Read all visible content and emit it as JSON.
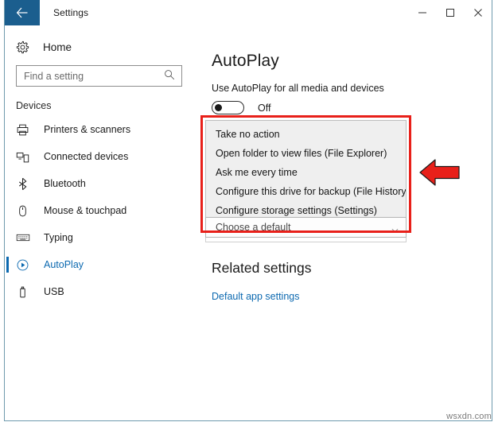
{
  "window": {
    "title": "Settings",
    "back_icon": "back-arrow-icon",
    "minimize_label": "Minimize",
    "maximize_label": "Maximize",
    "close_label": "Close"
  },
  "sidebar": {
    "home": {
      "label": "Home",
      "icon": "gear-icon"
    },
    "search": {
      "placeholder": "Find a setting",
      "value": "",
      "icon": "search-icon"
    },
    "section_label": "Devices",
    "items": [
      {
        "label": "Printers & scanners",
        "icon": "printer-icon",
        "selected": false
      },
      {
        "label": "Connected devices",
        "icon": "connected-devices-icon",
        "selected": false
      },
      {
        "label": "Bluetooth",
        "icon": "bluetooth-icon",
        "selected": false
      },
      {
        "label": "Mouse & touchpad",
        "icon": "mouse-icon",
        "selected": false
      },
      {
        "label": "Typing",
        "icon": "keyboard-icon",
        "selected": false
      },
      {
        "label": "AutoPlay",
        "icon": "autoplay-icon",
        "selected": true
      },
      {
        "label": "USB",
        "icon": "usb-icon",
        "selected": false
      }
    ]
  },
  "main": {
    "page_title": "AutoPlay",
    "toggle": {
      "label": "Use AutoPlay for all media and devices",
      "state_text": "Off",
      "checked": false
    },
    "dropdown": {
      "open": true,
      "options": [
        "Take no action",
        "Open folder to view files (File Explorer)",
        "Ask me every time",
        "Configure this drive for backup (File History)",
        "Configure storage settings (Settings)"
      ],
      "selected_value": "Choose a default",
      "chevron_icon": "chevron-down-icon"
    },
    "related": {
      "title": "Related settings",
      "link_label": "Default app settings"
    }
  },
  "annotations": {
    "highlight_color": "#e8201a",
    "arrow_icon": "left-arrow-annotation",
    "arrow_color": "#e8201a"
  },
  "watermark": {
    "text": "wsxdn.com"
  },
  "colors": {
    "accent": "#0c69b0",
    "titlebar_back": "#1b5e8e",
    "window_border": "#6f9aad",
    "panel_bg": "#efefef"
  }
}
